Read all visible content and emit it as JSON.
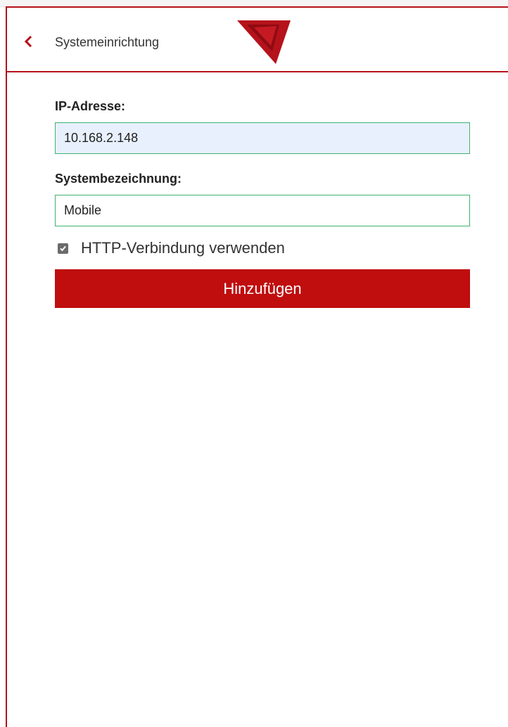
{
  "header": {
    "title": "Systemeinrichtung",
    "back_icon": "chevron-left-icon",
    "logo_icon": "triangle-logo-icon"
  },
  "form": {
    "ip_label": "IP-Adresse:",
    "ip_value": "10.168.2.148",
    "name_label": "Systembezeichnung:",
    "name_value": "Mobile",
    "http_checkbox_label": "HTTP-Verbindung verwenden",
    "http_checkbox_checked": true,
    "submit_label": "Hinzufügen"
  },
  "colors": {
    "accent": "#b5121b",
    "button": "#c00d0e",
    "input_border": "#3cb371",
    "autofill_bg": "#e8f0fe"
  }
}
